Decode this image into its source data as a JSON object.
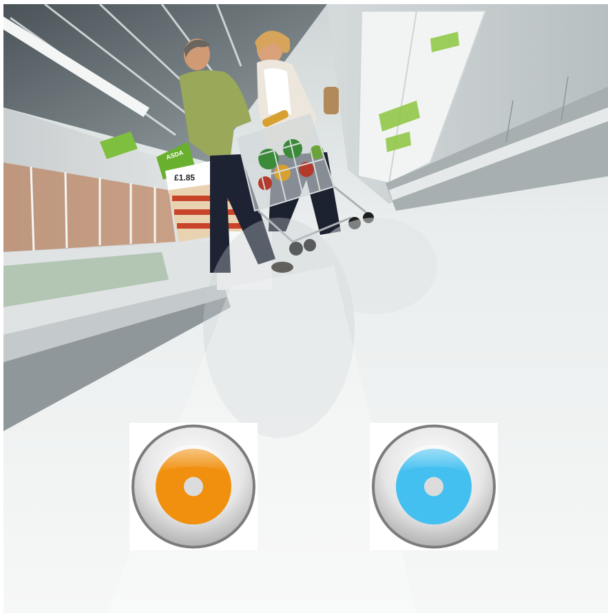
{
  "scene": {
    "price_tag": "1.85",
    "currency_symbol": "£",
    "brand_sign": "ASDA",
    "colors": {
      "floor": "#eef0f0",
      "shelf_green": "#7fbf3f",
      "shirt": "#9aa85a",
      "trousers": "#1d2333"
    }
  },
  "controls": {
    "orange_button": {
      "icon": "record-icon",
      "fill": "#f0900e"
    },
    "blue_button": {
      "icon": "record-icon",
      "fill": "#44c0f0"
    }
  }
}
